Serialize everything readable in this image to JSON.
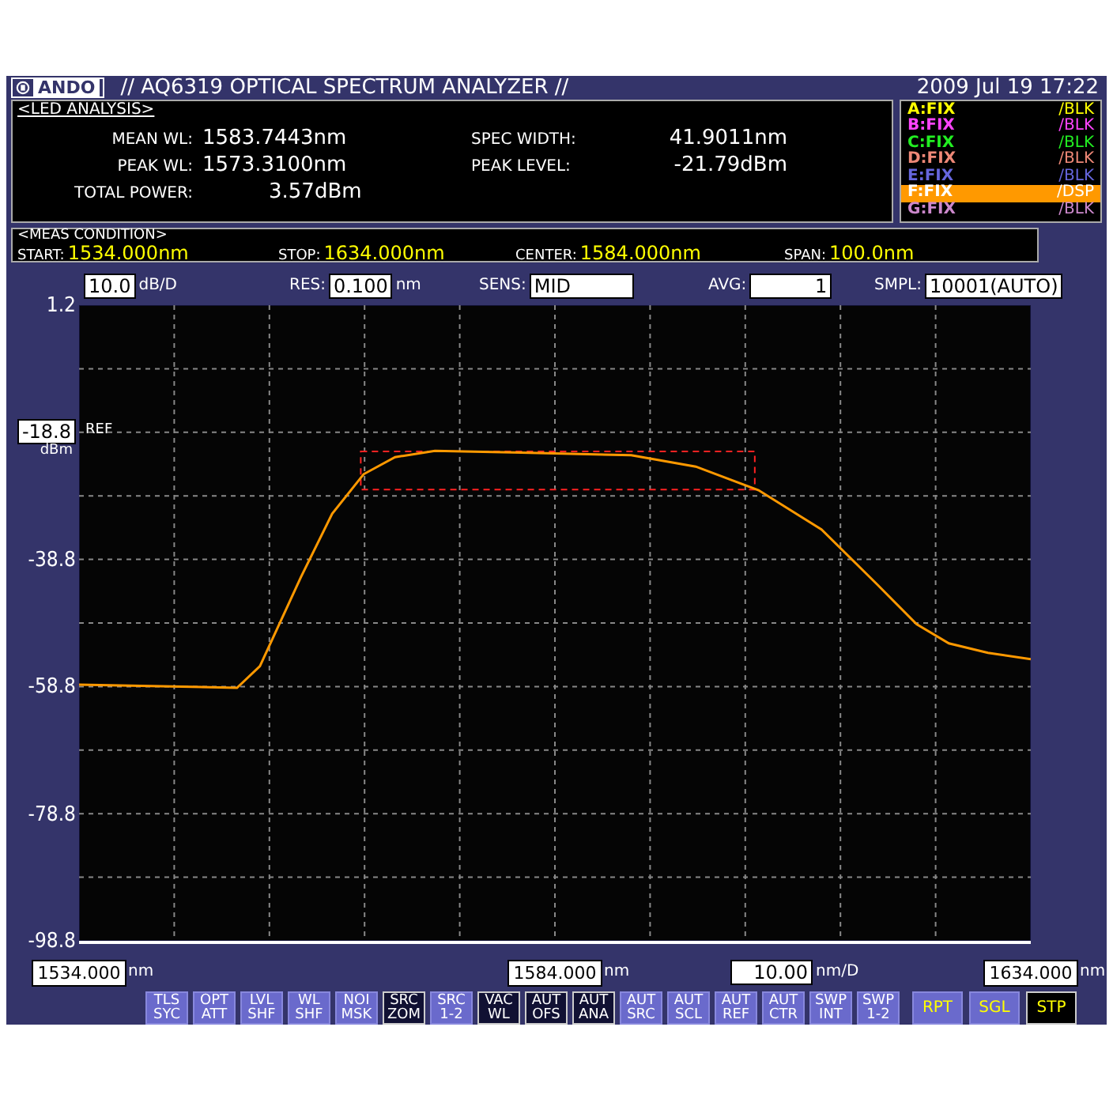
{
  "header": {
    "logo": "ANDO",
    "title": "// AQ6319 OPTICAL SPECTRUM ANALYZER //",
    "datetime": "2009 Jul 19 17:22"
  },
  "analysis": {
    "title": "<LED ANALYSIS>",
    "fields": [
      {
        "label": "MEAN WL:",
        "value": "1583.7443nm"
      },
      {
        "label": "PEAK WL:",
        "value": "1573.3100nm"
      },
      {
        "label": "TOTAL POWER:",
        "value": "3.57dBm"
      },
      {
        "label": "SPEC WIDTH:",
        "value": "41.9011nm"
      },
      {
        "label": "PEAK LEVEL:",
        "value": "-21.79dBm"
      }
    ]
  },
  "traces": [
    {
      "label": "A:FIX",
      "mode": "/BLK",
      "color": "#ffff00",
      "selected": false
    },
    {
      "label": "B:FIX",
      "mode": "/BLK",
      "color": "#ff44ff",
      "selected": false
    },
    {
      "label": "C:FIX",
      "mode": "/BLK",
      "color": "#22ee22",
      "selected": false
    },
    {
      "label": "D:FIX",
      "mode": "/BLK",
      "color": "#ee8877",
      "selected": false
    },
    {
      "label": "E:FIX",
      "mode": "/BLK",
      "color": "#6666dd",
      "selected": false
    },
    {
      "label": "F:FIX",
      "mode": "/DSP",
      "color": "#ff9900",
      "selected": true
    },
    {
      "label": "G:FIX",
      "mode": "/BLK",
      "color": "#cc88cc",
      "selected": false
    }
  ],
  "meas_condition": {
    "title": "<MEAS CONDITION>",
    "fields": [
      {
        "label": "START:",
        "value": "1534.000nm"
      },
      {
        "label": "STOP:",
        "value": "1634.000nm"
      },
      {
        "label": "CENTER:",
        "value": "1584.000nm"
      },
      {
        "label": "SPAN:",
        "value": "100.0nm"
      }
    ]
  },
  "settings": [
    {
      "value": "10.0",
      "unit": "dB/D"
    },
    {
      "label": "RES:",
      "value": "0.100",
      "unit": "nm"
    },
    {
      "label": "SENS:",
      "value": "MID"
    },
    {
      "label": "AVG:",
      "value": "1"
    },
    {
      "label": "SMPL:",
      "value": "10001(AUTO)"
    }
  ],
  "ref_level": {
    "value": "-18.8",
    "label": "REF",
    "unit": "dBm"
  },
  "chart_data": {
    "type": "line",
    "grid": true,
    "xlim": [
      1534,
      1634
    ],
    "ylim": [
      -98.8,
      1.2
    ],
    "yticks": [
      {
        "value": 1.2,
        "label": "1.2"
      },
      {
        "value": -38.8,
        "label": "-38.8"
      },
      {
        "value": -58.8,
        "label": "-58.8"
      },
      {
        "value": -78.8,
        "label": "-78.8"
      },
      {
        "value": -98.8,
        "label": "-98.8"
      }
    ],
    "xticks": [
      {
        "value": 1534,
        "label": "1534.000"
      },
      {
        "value": 1584,
        "label": "1584.000"
      },
      {
        "value": 1634,
        "label": "1634.000"
      }
    ],
    "x": [
      1534,
      1550.6,
      1553,
      1557.3,
      1560.6,
      1563.9,
      1567.2,
      1571.4,
      1580.5,
      1592,
      1598.8,
      1605.4,
      1612,
      1617.9,
      1622,
      1625.4,
      1629.5,
      1634
    ],
    "series": [
      {
        "color": "#ff9900",
        "values": [
          -58.5,
          -59,
          -55.6,
          -41.6,
          -31.6,
          -25.4,
          -22.7,
          -21.7,
          -22,
          -22.4,
          -24.2,
          -27.9,
          -34.1,
          -42.8,
          -49,
          -52,
          -53.5,
          -54.5
        ]
      }
    ]
  },
  "x_tick_units": [
    "nm",
    "nm",
    "nm"
  ],
  "span_per_division": {
    "value": "10.00",
    "unit": "nm/D"
  },
  "soft_keys": [
    {
      "line1": "TLS",
      "line2": "SYC",
      "active": false
    },
    {
      "line1": "OPT",
      "line2": "ATT",
      "active": false
    },
    {
      "line1": "LVL",
      "line2": "SHF",
      "active": false
    },
    {
      "line1": "WL",
      "line2": "SHF",
      "active": false
    },
    {
      "line1": "NOI",
      "line2": "MSK",
      "active": false
    },
    {
      "line1": "SRC",
      "line2": "ZOM",
      "active": true
    },
    {
      "line1": "SRC",
      "line2": "1-2",
      "active": false
    },
    {
      "line1": "VAC",
      "line2": "WL",
      "active": true
    },
    {
      "line1": "AUT",
      "line2": "OFS",
      "active": true
    },
    {
      "line1": "AUT",
      "line2": "ANA",
      "active": true
    },
    {
      "line1": "AUT",
      "line2": "SRC",
      "active": false
    },
    {
      "line1": "AUT",
      "line2": "SCL",
      "active": false
    },
    {
      "line1": "AUT",
      "line2": "REF",
      "active": false
    },
    {
      "line1": "AUT",
      "line2": "CTR",
      "active": false
    },
    {
      "line1": "SWP",
      "line2": "INT",
      "active": false
    },
    {
      "line1": "SWP",
      "line2": "1-2",
      "active": false
    }
  ],
  "sweep_keys": [
    {
      "label": "RPT",
      "active": false
    },
    {
      "label": "SGL",
      "active": false
    },
    {
      "label": "STP",
      "active": true
    }
  ]
}
